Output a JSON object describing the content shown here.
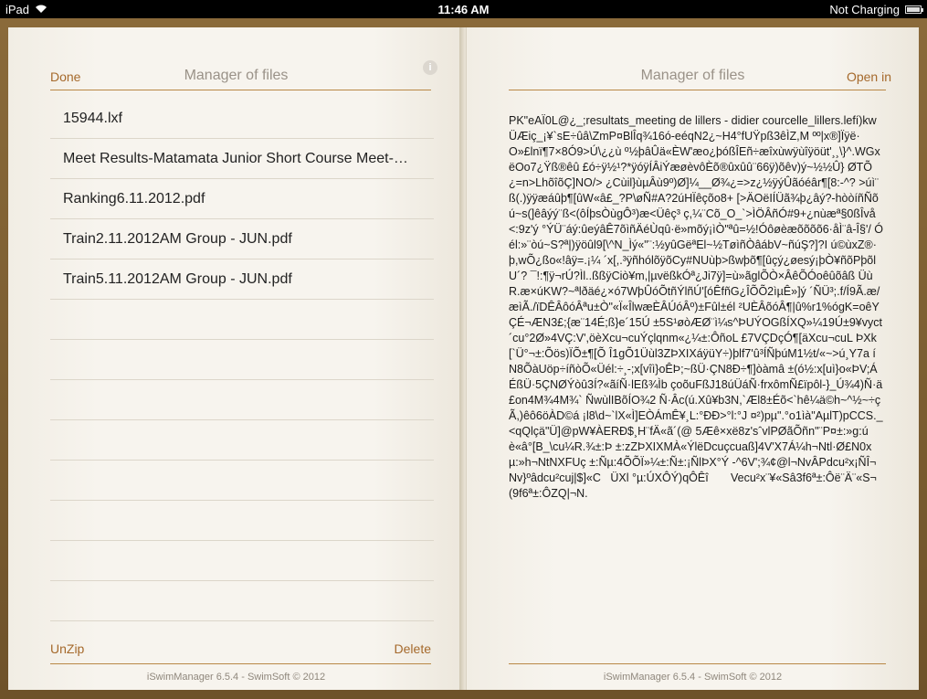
{
  "statusbar": {
    "device": "iPad",
    "time": "11:46 AM",
    "battery_status": "Not Charging"
  },
  "left_page": {
    "title": "Manager of files",
    "done_label": "Done",
    "info_icon": "info-icon",
    "files": [
      "15944.lxf",
      "Meet Results-Matamata Junior Short Course Meet-…",
      "Ranking6.11.2012.pdf",
      "Train2.11.2012AM Group - JUN.pdf",
      "Train5.11.2012AM Group - JUN.pdf"
    ],
    "unzip_label": "UnZip",
    "delete_label": "Delete",
    "footer": "iSwimManager  6.5.4 - SwimSoft © 2012"
  },
  "right_page": {
    "title": "Manager of files",
    "open_in_label": "Open in",
    "content": "PK\"eAÏ0L@¿_;resultats_meeting de lillers - didier courcelle_lillers.lefí)kwÜÆiç_¡¥`sE÷ûâ\\ZmP¤BlÎq¾16ó-eéqN2¿~H4°fUŸpß3êÌZ,M ºº|x®]Ïÿë·O»£lnï¶7×8Ó9>Ú\\¿¿ù º½þâÛä«ÈW'æo¿þóßÎEñ÷æîxùwÿùîÿöüt'¸¸\\}^.WGxëOo7¿Ÿß®êû £ó÷ÿ½¹?*ÿóÿÍÂiÝæøèvôÈõ®ûxûû¨66ÿ)õêv)ý~½½Û} ØTÕ¿=n>LhõîõÇ]NO/> ¿Cùil}ùµÂù9º)Ø]¼__Ø¾¿=>z¿½ÿýÛãóéâr¶[8:-^? >úì¨ß(.)ÿÿæáûþ¶[ûW«â£_?P\\øÑ#A?2úHÏêçõo8+ [>ÄOëIÍÜã¾þ¿âý?-hòòíñÑõú~s(]êâýý¨ß<(ôÍþsÒùgÔ³)æ<Üêç³ ç,¼¨Cõ_O_`>ÌÖÂñÓ#9+¿nùæª§0ßÎvå<:9z'ý °ÝÜ¨áý:ûeýâÊ7õìñÄéÙqû·ë»mõý¡ìÒ\"ªû=½!Óôøèæõõõõ6·åÌ¨â-Î§'/ Óél:»¨òú~S?ª|)ÿöûl9[\\^N_Ìý«\"¨:½yûGëªEl~½TøìñÒâábV~ñúŞ?]?I ú©ùxZ®·þ,wÕ¿ßo«!âÿ=.¡¼ ´x[,.³ÿñhólõÿõCy#NUùþ>ßwþõ¶[ûçý¿øesý¡þÒ¥ñõPþõlU´? ¯!:¶ÿ¬rÚ?Ìl..ßßÿCiò¥m,|µvëßkÓª¿Ji7ÿ]=ù»ãglÕÒ×ÂêÕÓoêûõâß ÜùR.æ×úKW?~ªlðäé¿×ó7WþÛóÕtñÝlñÚ'[óÊfñG¿ÎÕÕ2ìµÊ»]ý ´ÑÜ³;.f/Í9Ã.æ/æìÃ./ïDÊÂôóÂªu±Ò\"«Ï«ÎlwæÈÂÚóÂº)±Fûl±él ²UÈÂõóÂ¶|û%r1%ógK=oêYÇÉ¬ÆN3£;{æ¨14É;ß}e´15Ú ±5S¹øòÆØ¨ì¼s^ÞUÝOGßÍXQ»¼19Ú±9¥vyct ´cu°2Ø»4VÇ:V',öèXcu¬cuÝçlqnm«¿¼±:ÔñoL £7VÇDçÓ¶[äXcu¬cuL ÞXk[`Ü°¬±:Õös)ÏÕ±¶[Õ Î1gÕ1Üùl3ZÞXIXáÿüY÷)þlf7'û³ÍÑþúM1½t/«~>ú¸Y7a íN8ÕàUöp÷íñòÕ«Üél:÷¸-;x[vîì}oÊÞ;~ßÜ·ÇN8Ð÷¶]òàmâ ±(ó½:x[uì}o«ÞV;ÁÉßÜ·5ÇNØÝòû3Í?«ãíÑ·lEß¾Ìb çoõuFßJ18úÜáÑ·frxômÑ£ïpôl-}_Ú¾4)Ñ·ä£on4M¾4M¾` ÑwùlIBõÍO¾2 Ñ·Âc(ú.Xû¥b3N,`Æl8±Éõ<`hê¼ä©h~^½~÷ç Ã,)êô6öÀD©á ¡l8\\d~`lX«Ì]EÒÁmÊ¥¸L:°ÐÐ>°l:°J ¤²)pµ\".°o1ìà\"AµlT)pCCS._<qQlçä\"Ü]@pW¥ÀERÐ$¸H¨fÄ«ã´(@ 5Æê×xë8z'sˆvlPØãÕñn\"¨P¤±:»g:úè«â°[B_\\cu¼R.¾±:Þ ±:zZÞXIXMÀ«ÝlëDcuçcuaß]4V'X7Á¼h¬Ntl·Ø£N0xµ:»h¬NtNXFUç ±:Ñµ:4ÕÕÏ»¼±:Ñ±:¡ÑlÞX°Ý -^6V';¾¢@l¬NvÂPdcu²x¡ÑÎ¬Nv}ºâdcu²cuj|$]«C   ÜXl °µ:ÚXÔÝ)qÔÊî       Vecu²x¨¥«Sâ3f6ª±:Ôë¨Ä¨«S¬(9f6ª±:ÔZQ|¬N."
  },
  "right_footer": "iSwimManager  6.5.4 - SwimSoft © 2012"
}
